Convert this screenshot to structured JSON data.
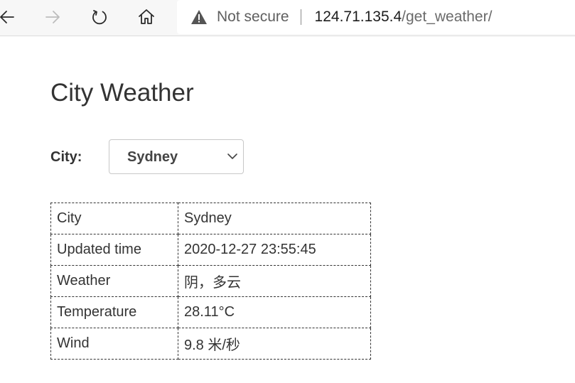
{
  "browser": {
    "security_text": "Not secure",
    "url_host": "124.71.135.4",
    "url_path": "/get_weather/"
  },
  "page": {
    "title": "City Weather",
    "city_label": "City:",
    "city_selected": "Sydney"
  },
  "table": {
    "rows": [
      {
        "label": "City",
        "value": "Sydney"
      },
      {
        "label": "Updated time",
        "value": "2020-12-27 23:55:45"
      },
      {
        "label": "Weather",
        "value": "阴，多云"
      },
      {
        "label": "Temperature",
        "value": "28.11°C"
      },
      {
        "label": "Wind",
        "value": "9.8 米/秒"
      }
    ]
  }
}
